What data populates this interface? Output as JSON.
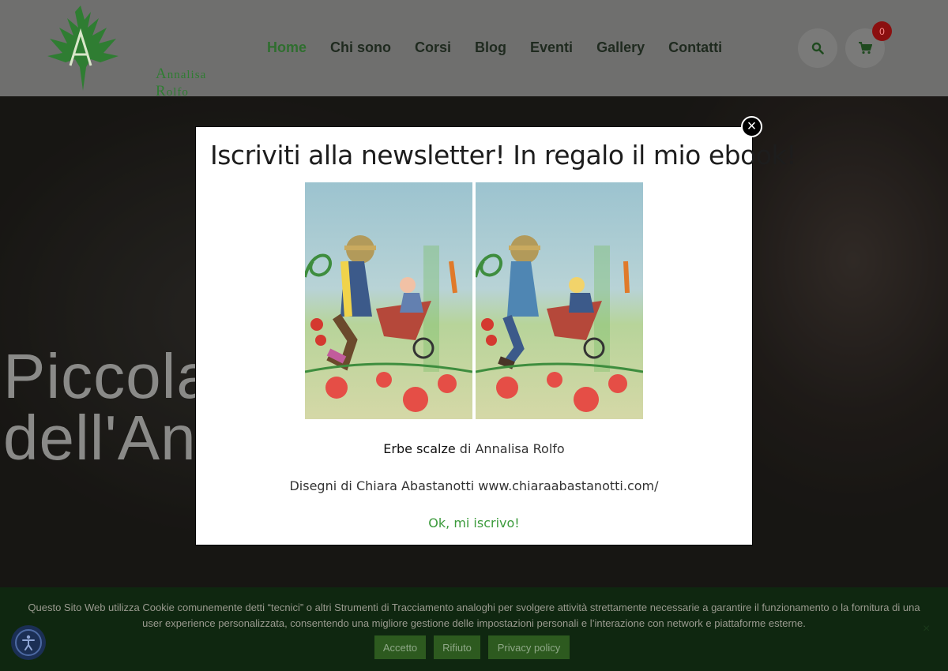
{
  "header": {
    "logo_text_initial": "A",
    "logo_text_rest": "nnalisa ",
    "logo_text_initial2": "R",
    "logo_text_rest2": "olfo",
    "nav": [
      {
        "label": "Home",
        "active": true
      },
      {
        "label": "Chi sono"
      },
      {
        "label": "Corsi"
      },
      {
        "label": "Blog"
      },
      {
        "label": "Eventi"
      },
      {
        "label": "Gallery"
      },
      {
        "label": "Contatti"
      }
    ],
    "cart_count": "0",
    "search_icon": "search-icon",
    "cart_icon": "cart-icon"
  },
  "hero": {
    "line1": "Piccola",
    "line2": "dell'An"
  },
  "modal": {
    "title": "Iscriviti alla newsletter! In regalo il mio ebook!",
    "book_title": "Erbe scalze",
    "book_author": " di Annalisa Rolfo",
    "credits": "Disegni di Chiara Abastanotti  www.chiaraabastanotti.com/",
    "cta": "Ok, mi iscrivo!",
    "close_label": "×"
  },
  "cookie": {
    "text": "Questo Sito Web utilizza Cookie comunemente detti “tecnici” o altri Strumenti di Tracciamento analoghi per svolgere attività strettamente necessarie a garantire il funzionamento o la fornitura di una user experience personalizzata, consentendo una migliore gestione delle impostazioni personali e l’interazione con network e piattaforme esterne.",
    "accept": "Accetto",
    "reject": "Rifiuto",
    "privacy": "Privacy policy",
    "close": "×"
  },
  "colors": {
    "brand_green": "#2f7d32",
    "cta_green": "#3b9a3b",
    "badge_red": "#8b0f0f"
  }
}
